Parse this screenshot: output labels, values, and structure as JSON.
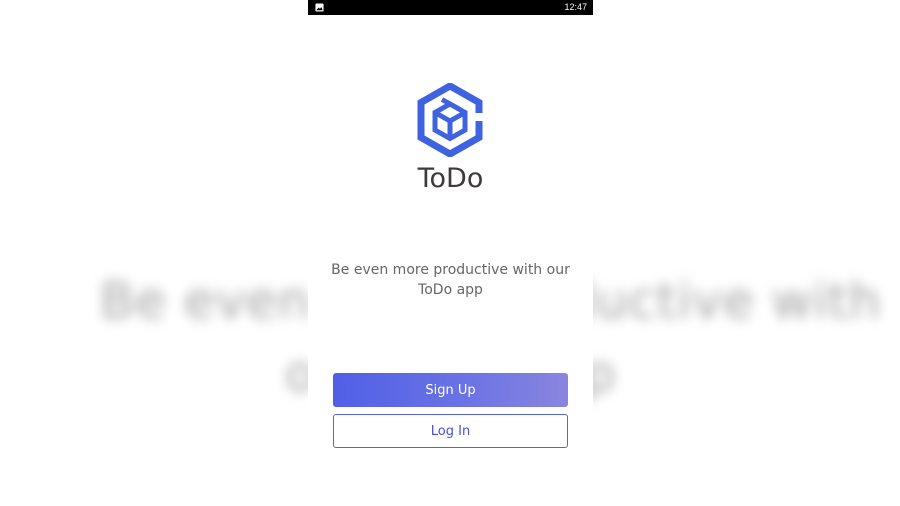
{
  "status_bar": {
    "time": "12:47",
    "left_icon": "image-notification-icon"
  },
  "brand": {
    "logo_icon": "hexagon-box-logo",
    "app_name": "ToDo",
    "logo_color": "#3f63e0"
  },
  "tagline": "Be even more productive with our ToDo app",
  "actions": {
    "signup_label": "Sign Up",
    "login_label": "Log In"
  },
  "colors": {
    "accent": "#5060e6",
    "accent_end": "#8a85df",
    "text_dark": "#3f3a3a",
    "text_muted": "#666666"
  }
}
